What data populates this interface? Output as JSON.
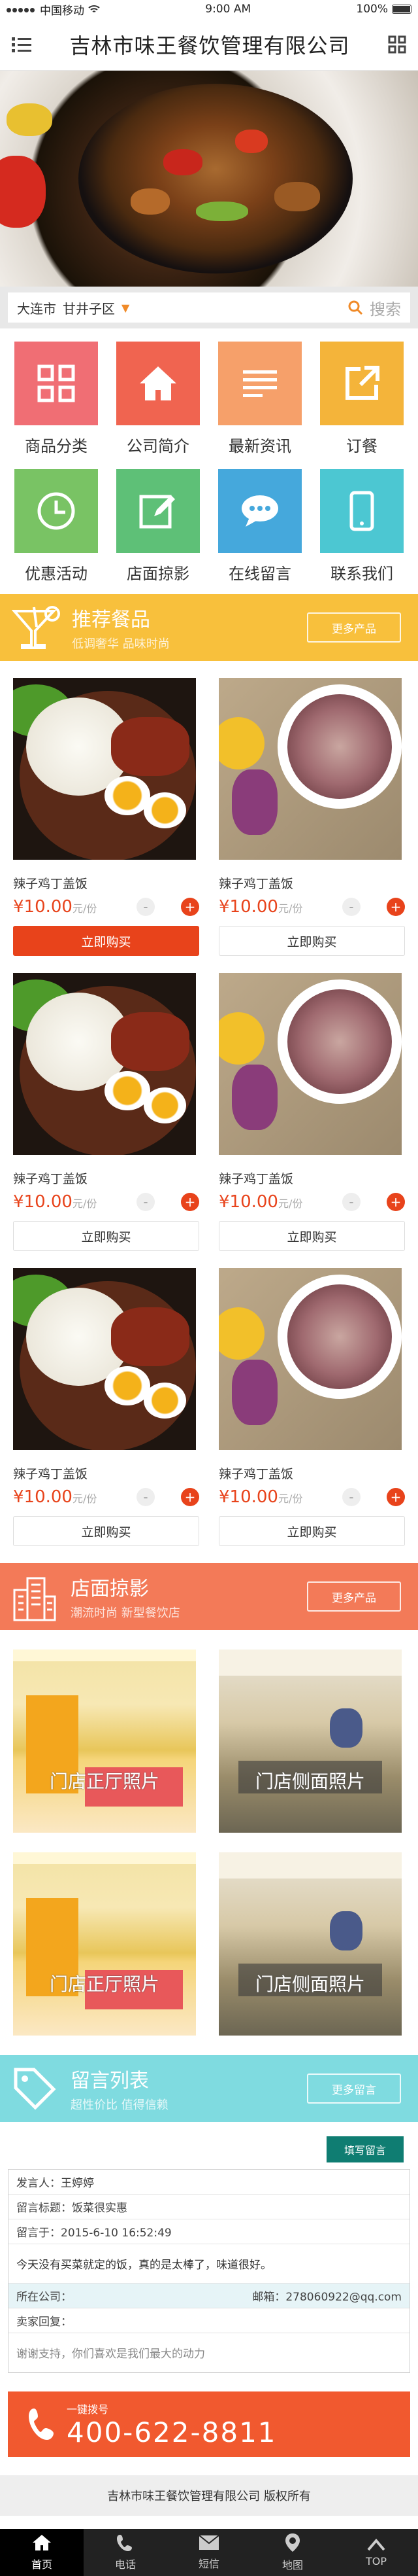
{
  "status": {
    "carrier": "中国移动",
    "time": "9:00 AM",
    "battery": "100%"
  },
  "header": {
    "title": "吉林市味王餐饮管理有限公司",
    "menu_icon": "list-icon",
    "grid_icon": "grid-icon"
  },
  "location": {
    "city": "大连市",
    "district": "甘井子区",
    "search_label": "搜索"
  },
  "categories": [
    {
      "label": "商品分类",
      "color": "#f06e74",
      "icon": "grid-icon"
    },
    {
      "label": "公司简介",
      "color": "#f06450",
      "icon": "home-icon"
    },
    {
      "label": "最新资讯",
      "color": "#f6a06a",
      "icon": "list-icon"
    },
    {
      "label": "订餐",
      "color": "#f4b43a",
      "icon": "share-icon"
    },
    {
      "label": "优惠活动",
      "color": "#79c364",
      "icon": "clock-icon"
    },
    {
      "label": "店面掠影",
      "color": "#5ec077",
      "icon": "edit-icon"
    },
    {
      "label": "在线留言",
      "color": "#45a8dc",
      "icon": "chat-icon"
    },
    {
      "label": "联系我们",
      "color": "#4cc7d2",
      "icon": "phone-icon"
    }
  ],
  "recommend": {
    "title": "推荐餐品",
    "subtitle": "低调奢华 品味时尚",
    "more": "更多产品",
    "color": "#f8c03c"
  },
  "products": [
    {
      "name": "辣子鸡丁盖饭",
      "price": "¥10.00",
      "unit": "元/份",
      "buy": "立即购买",
      "active": true
    },
    {
      "name": "辣子鸡丁盖饭",
      "price": "¥10.00",
      "unit": "元/份",
      "buy": "立即购买",
      "active": false
    },
    {
      "name": "辣子鸡丁盖饭",
      "price": "¥10.00",
      "unit": "元/份",
      "buy": "立即购买",
      "active": false
    },
    {
      "name": "辣子鸡丁盖饭",
      "price": "¥10.00",
      "unit": "元/份",
      "buy": "立即购买",
      "active": false
    },
    {
      "name": "辣子鸡丁盖饭",
      "price": "¥10.00",
      "unit": "元/份",
      "buy": "立即购买",
      "active": false
    },
    {
      "name": "辣子鸡丁盖饭",
      "price": "¥10.00",
      "unit": "元/份",
      "buy": "立即购买",
      "active": false
    }
  ],
  "store_section": {
    "title": "店面掠影",
    "subtitle": "潮流时尚 新型餐饮店",
    "more": "更多产品",
    "color": "#f37a58"
  },
  "stores": [
    {
      "caption": "门店正厅照片"
    },
    {
      "caption": "门店侧面照片"
    },
    {
      "caption": "门店正厅照片"
    },
    {
      "caption": "门店侧面照片"
    }
  ],
  "message_section": {
    "title": "留言列表",
    "subtitle": "超性价比 值得信赖",
    "more": "更多留言",
    "color": "#7fdbe0"
  },
  "message": {
    "post_button": "填写留言",
    "poster": "发言人：王婷婷",
    "subject": "留言标题：饭菜很实惠",
    "time": "留言于：2015-6-10  16:52:49",
    "content": "今天没有买菜就定的饭，真的是太棒了，味道很好。",
    "company": "所在公司：",
    "email": "邮箱：278060922@qq.com",
    "reply_label": "卖家回复：",
    "reply": "谢谢支持，你们喜欢是我们最大的动力"
  },
  "call": {
    "label": "一键拨号",
    "number": "400-622-8811"
  },
  "footer": {
    "text": "吉林市味王餐饮管理有限公司 版权所有"
  },
  "tabs": [
    {
      "label": "首页",
      "icon": "home-icon",
      "active": true
    },
    {
      "label": "电话",
      "icon": "phone-icon",
      "active": false
    },
    {
      "label": "短信",
      "icon": "mail-icon",
      "active": false
    },
    {
      "label": "地图",
      "icon": "map-pin-icon",
      "active": false
    },
    {
      "label": "TOP",
      "icon": "up-arrow-icon",
      "active": false
    }
  ]
}
